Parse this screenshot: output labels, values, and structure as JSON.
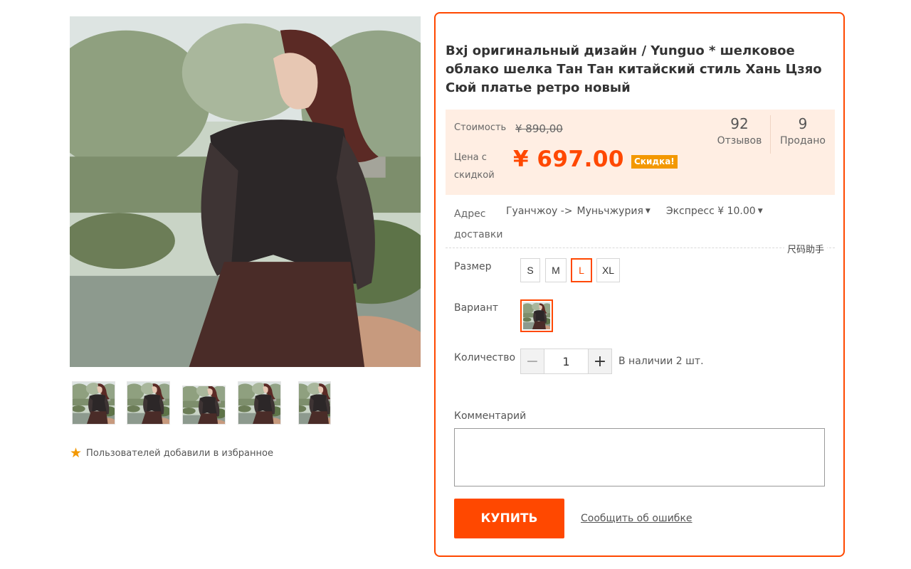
{
  "product": {
    "title": "Bxj оригинальный дизайн / Yunguo * шелковое облако шелка Тан Тан китайский стиль Хань Цзяо Сюй платье ретро новый"
  },
  "gallery": {
    "thumbnail_count": 5,
    "favorites_text": "Пользователей добавили в избранное",
    "favorites_icon": "star-icon",
    "star_color": "#f39800"
  },
  "pricing": {
    "old_label": "Стоимость",
    "old_price": "¥ 890,00",
    "new_label": "Цена с скидкой",
    "new_price": "¥ 697.00",
    "badge": "Скидка!",
    "accent_color": "#ff4800",
    "background_color": "#ffeee3"
  },
  "stats": {
    "reviews_count": "92",
    "reviews_label": "Отзывов",
    "sold_count": "9",
    "sold_label": "Продано"
  },
  "shipping": {
    "label": "Адрес доставки",
    "from": "Гуанчжоу ->",
    "to": "Муньчжурия",
    "method": "Экспресс ¥ 10.00"
  },
  "size_guide": "尺码助手",
  "size": {
    "label": "Размер",
    "options": [
      "S",
      "M",
      "L",
      "XL"
    ],
    "selected": "L"
  },
  "variant": {
    "label": "Вариант"
  },
  "quantity": {
    "label": "Количество",
    "value": "1",
    "minus": "−",
    "plus": "+",
    "stock": "В наличии 2 шт."
  },
  "comment": {
    "label": "Комментарий",
    "value": ""
  },
  "actions": {
    "buy": "КУПИТЬ",
    "report": "Сообщить об ошибке"
  }
}
